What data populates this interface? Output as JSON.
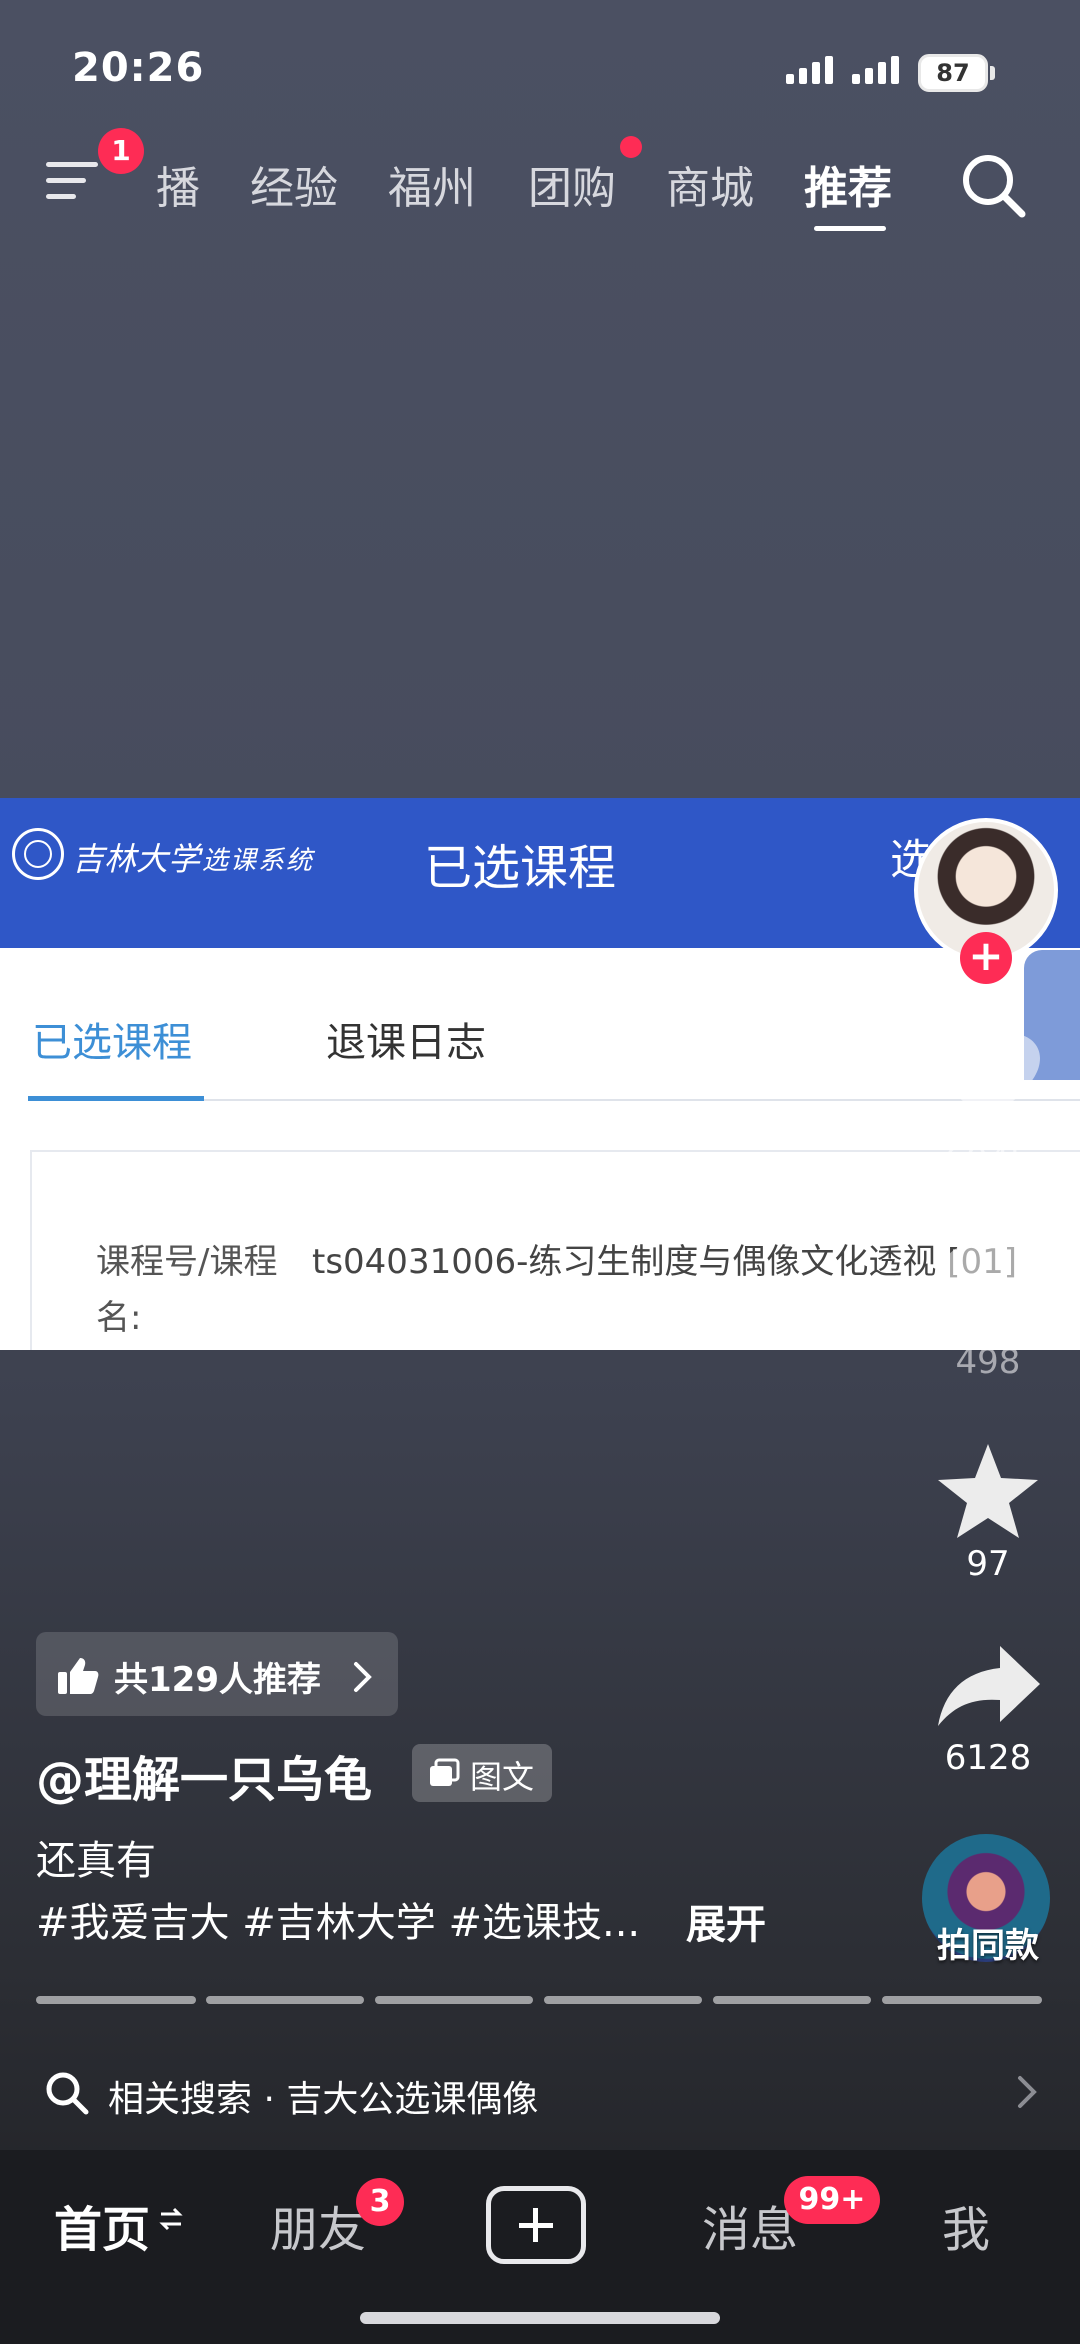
{
  "status_bar": {
    "time": "20:26",
    "battery": "87"
  },
  "top_nav": {
    "menu_badge": "1",
    "tabs": [
      "播",
      "经验",
      "福州",
      "团购",
      "商城",
      "推荐"
    ],
    "active_tab": "推荐"
  },
  "embedded_image": {
    "school_name": "吉林大学",
    "system_name": "选课系统",
    "page_title": "已选课程",
    "header_right": "选",
    "tabs": [
      "已选课程",
      "退课日志"
    ],
    "field_label": "课程号/课程名:",
    "field_value": "ts04031006-练习生制度与偶像文化透视 [01]"
  },
  "actions": {
    "likes": "6945",
    "comments": "498",
    "favorites": "97",
    "shares": "6128",
    "music_label": "拍同款"
  },
  "post": {
    "recommend_text": "共129人推荐",
    "author": "@理解一只乌龟",
    "type_label": "图文",
    "caption_line1": "还真有",
    "caption_line2": "#我爱吉大 #吉林大学 #选课技...",
    "expand_label": "展开",
    "slide_count_note": "6"
  },
  "related_search": {
    "text": "相关搜索 · 吉大公选课偶像"
  },
  "bottom_nav": {
    "home": "首页",
    "friends": "朋友",
    "friends_badge": "3",
    "messages": "消息",
    "messages_badge": "99+",
    "me": "我"
  },
  "colors": {
    "accent": "#fe2c55",
    "header_blue": "#2f57c7",
    "tab_blue": "#3d8fd6"
  }
}
